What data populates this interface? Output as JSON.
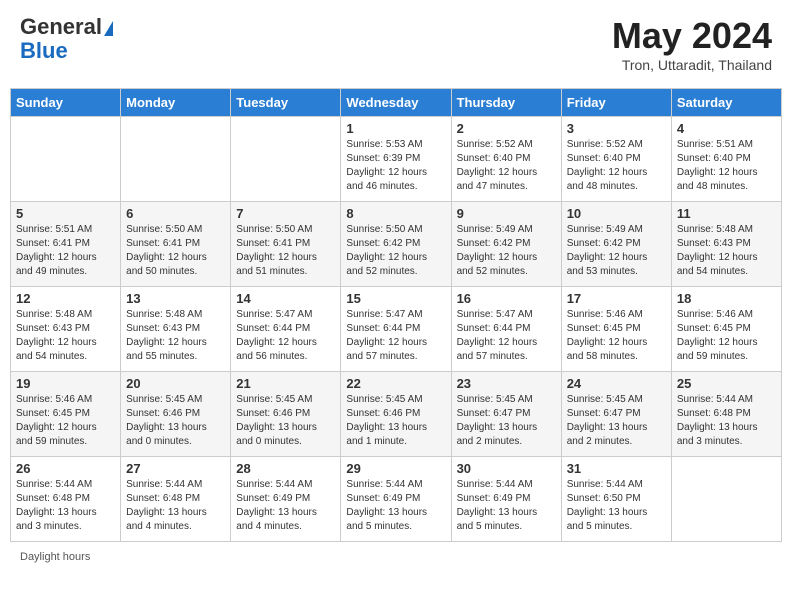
{
  "header": {
    "logo_line1": "General",
    "logo_line2": "Blue",
    "month_title": "May 2024",
    "location": "Tron, Uttaradit, Thailand"
  },
  "weekdays": [
    "Sunday",
    "Monday",
    "Tuesday",
    "Wednesday",
    "Thursday",
    "Friday",
    "Saturday"
  ],
  "weeks": [
    [
      {
        "day": "",
        "info": ""
      },
      {
        "day": "",
        "info": ""
      },
      {
        "day": "",
        "info": ""
      },
      {
        "day": "1",
        "info": "Sunrise: 5:53 AM\nSunset: 6:39 PM\nDaylight: 12 hours\nand 46 minutes."
      },
      {
        "day": "2",
        "info": "Sunrise: 5:52 AM\nSunset: 6:40 PM\nDaylight: 12 hours\nand 47 minutes."
      },
      {
        "day": "3",
        "info": "Sunrise: 5:52 AM\nSunset: 6:40 PM\nDaylight: 12 hours\nand 48 minutes."
      },
      {
        "day": "4",
        "info": "Sunrise: 5:51 AM\nSunset: 6:40 PM\nDaylight: 12 hours\nand 48 minutes."
      }
    ],
    [
      {
        "day": "5",
        "info": "Sunrise: 5:51 AM\nSunset: 6:41 PM\nDaylight: 12 hours\nand 49 minutes."
      },
      {
        "day": "6",
        "info": "Sunrise: 5:50 AM\nSunset: 6:41 PM\nDaylight: 12 hours\nand 50 minutes."
      },
      {
        "day": "7",
        "info": "Sunrise: 5:50 AM\nSunset: 6:41 PM\nDaylight: 12 hours\nand 51 minutes."
      },
      {
        "day": "8",
        "info": "Sunrise: 5:50 AM\nSunset: 6:42 PM\nDaylight: 12 hours\nand 52 minutes."
      },
      {
        "day": "9",
        "info": "Sunrise: 5:49 AM\nSunset: 6:42 PM\nDaylight: 12 hours\nand 52 minutes."
      },
      {
        "day": "10",
        "info": "Sunrise: 5:49 AM\nSunset: 6:42 PM\nDaylight: 12 hours\nand 53 minutes."
      },
      {
        "day": "11",
        "info": "Sunrise: 5:48 AM\nSunset: 6:43 PM\nDaylight: 12 hours\nand 54 minutes."
      }
    ],
    [
      {
        "day": "12",
        "info": "Sunrise: 5:48 AM\nSunset: 6:43 PM\nDaylight: 12 hours\nand 54 minutes."
      },
      {
        "day": "13",
        "info": "Sunrise: 5:48 AM\nSunset: 6:43 PM\nDaylight: 12 hours\nand 55 minutes."
      },
      {
        "day": "14",
        "info": "Sunrise: 5:47 AM\nSunset: 6:44 PM\nDaylight: 12 hours\nand 56 minutes."
      },
      {
        "day": "15",
        "info": "Sunrise: 5:47 AM\nSunset: 6:44 PM\nDaylight: 12 hours\nand 57 minutes."
      },
      {
        "day": "16",
        "info": "Sunrise: 5:47 AM\nSunset: 6:44 PM\nDaylight: 12 hours\nand 57 minutes."
      },
      {
        "day": "17",
        "info": "Sunrise: 5:46 AM\nSunset: 6:45 PM\nDaylight: 12 hours\nand 58 minutes."
      },
      {
        "day": "18",
        "info": "Sunrise: 5:46 AM\nSunset: 6:45 PM\nDaylight: 12 hours\nand 59 minutes."
      }
    ],
    [
      {
        "day": "19",
        "info": "Sunrise: 5:46 AM\nSunset: 6:45 PM\nDaylight: 12 hours\nand 59 minutes."
      },
      {
        "day": "20",
        "info": "Sunrise: 5:45 AM\nSunset: 6:46 PM\nDaylight: 13 hours\nand 0 minutes."
      },
      {
        "day": "21",
        "info": "Sunrise: 5:45 AM\nSunset: 6:46 PM\nDaylight: 13 hours\nand 0 minutes."
      },
      {
        "day": "22",
        "info": "Sunrise: 5:45 AM\nSunset: 6:46 PM\nDaylight: 13 hours\nand 1 minute."
      },
      {
        "day": "23",
        "info": "Sunrise: 5:45 AM\nSunset: 6:47 PM\nDaylight: 13 hours\nand 2 minutes."
      },
      {
        "day": "24",
        "info": "Sunrise: 5:45 AM\nSunset: 6:47 PM\nDaylight: 13 hours\nand 2 minutes."
      },
      {
        "day": "25",
        "info": "Sunrise: 5:44 AM\nSunset: 6:48 PM\nDaylight: 13 hours\nand 3 minutes."
      }
    ],
    [
      {
        "day": "26",
        "info": "Sunrise: 5:44 AM\nSunset: 6:48 PM\nDaylight: 13 hours\nand 3 minutes."
      },
      {
        "day": "27",
        "info": "Sunrise: 5:44 AM\nSunset: 6:48 PM\nDaylight: 13 hours\nand 4 minutes."
      },
      {
        "day": "28",
        "info": "Sunrise: 5:44 AM\nSunset: 6:49 PM\nDaylight: 13 hours\nand 4 minutes."
      },
      {
        "day": "29",
        "info": "Sunrise: 5:44 AM\nSunset: 6:49 PM\nDaylight: 13 hours\nand 5 minutes."
      },
      {
        "day": "30",
        "info": "Sunrise: 5:44 AM\nSunset: 6:49 PM\nDaylight: 13 hours\nand 5 minutes."
      },
      {
        "day": "31",
        "info": "Sunrise: 5:44 AM\nSunset: 6:50 PM\nDaylight: 13 hours\nand 5 minutes."
      },
      {
        "day": "",
        "info": ""
      }
    ]
  ],
  "footer": {
    "daylight_label": "Daylight hours"
  }
}
